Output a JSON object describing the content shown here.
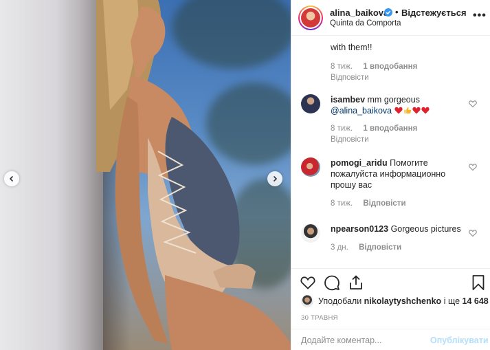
{
  "post": {
    "username": "alina_baikova",
    "separator": "•",
    "follow_state": "Відстежується",
    "location": "Quinta da Comporta",
    "more": "•••"
  },
  "photo": {
    "prev_icon": "chevron-left-icon",
    "next_icon": "chevron-right-icon"
  },
  "comments": [
    {
      "text": "with them!!",
      "time": "8 тиж.",
      "likes": "1 вподобання",
      "reply": "Відповісти"
    },
    {
      "user": "isambev",
      "text": "mm gorgeous",
      "mention": "@alina_baikova",
      "time": "8 тиж.",
      "likes": "1 вподобання",
      "reply": "Відповісти"
    },
    {
      "user": "pomogi_aridu",
      "text": "Помогите пожалуйста информационно прошу вас",
      "time": "8 тиж.",
      "reply": "Відповісти"
    },
    {
      "user": "npearson0123",
      "text": "Gorgeous pictures",
      "time": "3 дн.",
      "reply": "Відповісти"
    }
  ],
  "likes": {
    "prefix": "Уподобали",
    "user": "nikolaytyshchenko",
    "middle": "і ще",
    "count": "14 648"
  },
  "date": "30 ТРАВНЯ",
  "add_comment": {
    "placeholder": "Додайте коментар...",
    "publish": "Опублікувати"
  },
  "colors": {
    "accent_blue": "#0095f6",
    "publish_disabled": "#b2dffc",
    "verified": "#3897f0",
    "emoji_red": "#e0202b"
  }
}
